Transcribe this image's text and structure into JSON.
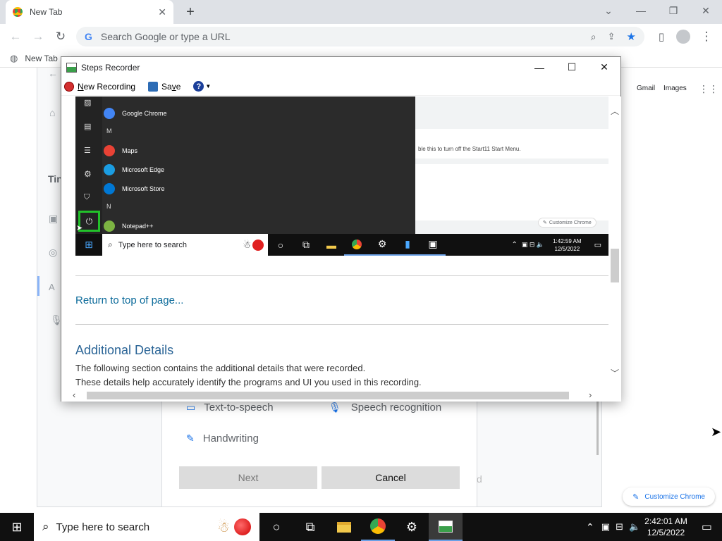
{
  "browser": {
    "tab_title": "New Tab",
    "omnibox_placeholder": "Search Google or type a URL",
    "bookmark": "New Tab",
    "header_links": [
      "Gmail",
      "Images"
    ],
    "customize_label": "Customize Chrome"
  },
  "background_page": {
    "title_fragment": "Tin",
    "options": [
      "Text-to-speech",
      "Speech recognition",
      "Handwriting"
    ],
    "next_label": "Next",
    "cancel_label": "Cancel",
    "hidden_fragment": "d"
  },
  "steps_recorder": {
    "title": "Steps Recorder",
    "menu": {
      "new_recording_prefix": "N",
      "new_recording_rest": "ew Recording",
      "save_prefix": "Sa",
      "save_u": "v",
      "save_rest": "e"
    },
    "screenshot": {
      "start_items": [
        {
          "label": "Google Chrome",
          "color": "#4285f4"
        },
        {
          "letter": "M"
        },
        {
          "label": "Maps",
          "color": "#e94235"
        },
        {
          "label": "Microsoft Edge",
          "color": "#1b9de2"
        },
        {
          "label": "Microsoft Store",
          "color": "#0078d4"
        },
        {
          "letter": "N"
        },
        {
          "label": "Notepad++",
          "color": "#7cb342"
        }
      ],
      "bg_text": "ble this to turn off the Start11 Start Menu.",
      "customize_small": "Customize Chrome",
      "taskbar_search": "Type here to search",
      "time": "1:42:59 AM",
      "date": "12/5/2022"
    },
    "return_link": "Return to top of page...",
    "additional_title": "Additional Details",
    "additional_lines": [
      "The following section contains the additional details that were recorded.",
      "These details help accurately identify the programs and UI you used in this recording."
    ]
  },
  "taskbar": {
    "search_placeholder": "Type here to search",
    "time": "2:42:01 AM",
    "date": "12/5/2022"
  },
  "colors": {
    "accent": "#1a73e8",
    "record_red": "#d32f2f",
    "link": "#0b6a9a",
    "highlight": "#22c22a"
  }
}
